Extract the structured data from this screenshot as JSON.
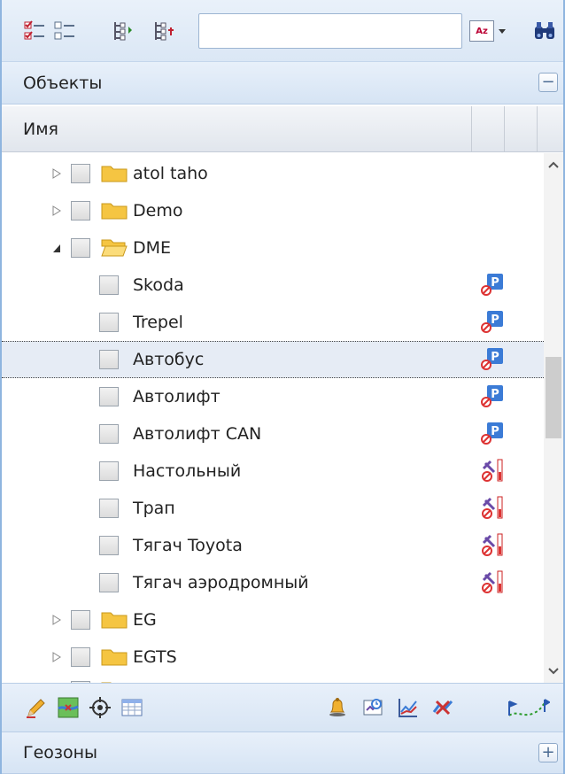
{
  "toolbar": {
    "icons": [
      "check-all-icon",
      "uncheck-all-icon",
      "expand-tree-icon",
      "collapse-tree-icon"
    ],
    "search": {
      "value": "",
      "placeholder": ""
    },
    "sort_label": "Az",
    "find_icon": "binoculars-icon"
  },
  "objects_panel": {
    "title": "Объекты",
    "toggle": "−"
  },
  "columns": {
    "name": "Имя"
  },
  "tree": {
    "groups_top": [
      {
        "label": "atol taho",
        "expanded": false
      },
      {
        "label": "Demo",
        "expanded": false
      }
    ],
    "dme": {
      "label": "DME",
      "expanded": true,
      "items": [
        {
          "label": "Skoda",
          "status": "parking-icon"
        },
        {
          "label": "Trepel",
          "status": "parking-icon"
        },
        {
          "label": "Автобус",
          "status": "parking-icon",
          "selected": true
        },
        {
          "label": "Автолифт",
          "status": "parking-icon"
        },
        {
          "label": "Автолифт CAN",
          "status": "parking-icon"
        },
        {
          "label": "Настольный",
          "status": "satellite-off-icon"
        },
        {
          "label": "Трап",
          "status": "satellite-off-icon"
        },
        {
          "label": "Тягач Toyota",
          "status": "satellite-off-icon"
        },
        {
          "label": "Тягач аэродромный",
          "status": "satellite-off-icon"
        }
      ]
    },
    "groups_bottom": [
      {
        "label": "EG",
        "expanded": false
      },
      {
        "label": "EGTS",
        "expanded": false
      }
    ]
  },
  "bottom_toolbar": {
    "left_icons": [
      "edit-icon",
      "map-icon",
      "locate-icon",
      "table-icon"
    ],
    "right_icons": [
      "notification-icon",
      "report-icon",
      "chart-icon",
      "delete-track-icon",
      "track-icon"
    ]
  },
  "geozones_panel": {
    "title": "Геозоны",
    "toggle": "+"
  },
  "colors": {
    "accent": "#8fb5df",
    "selected_row": "#e6ecf5",
    "folder": "#f5c542"
  }
}
